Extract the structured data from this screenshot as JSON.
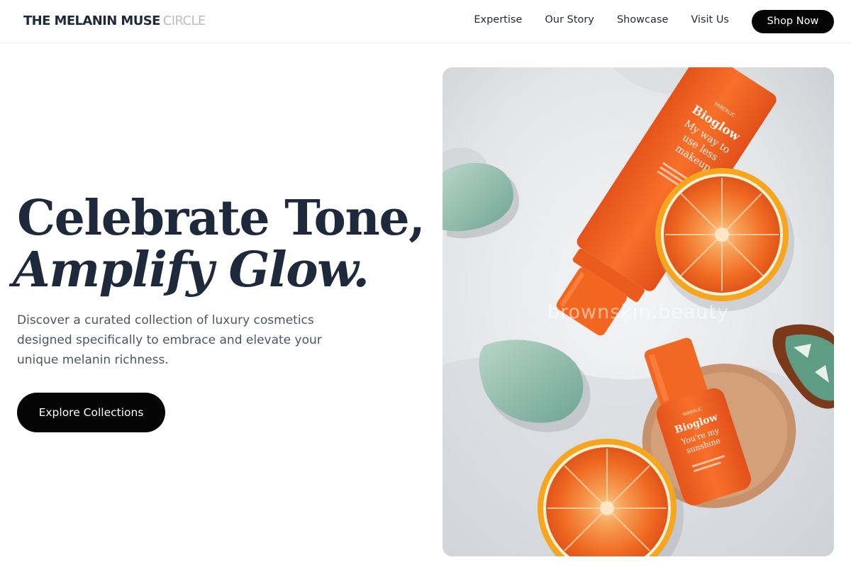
{
  "brand": {
    "name_bold": "THE MELANIN MUSE",
    "name_light": "CIRCLE"
  },
  "nav": {
    "links": [
      "Expertise",
      "Our Story",
      "Showcase",
      "Visit Us"
    ],
    "cta_label": "Shop Now"
  },
  "hero": {
    "headline_line1": "Celebrate Tone,",
    "headline_line2": "Amplify Glow.",
    "subtext": "Discover a curated collection of luxury cosmetics designed specifically to embrace and elevate your unique melanin richness.",
    "cta_label": "Explore Collections"
  },
  "image": {
    "watermark": "brownskin.beauty",
    "product_tube": {
      "brand": "FABERLIC",
      "name": "Bioglow",
      "tagline": "My way to use less makeup"
    },
    "product_bottle": {
      "brand": "FABERLIC",
      "name": "Bioglow",
      "tagline": "You're my sunshine"
    }
  },
  "colors": {
    "text_dark": "#1e2a3b",
    "text_muted": "#4c5563",
    "brand_light": "#b9bec6",
    "button_bg": "#050505",
    "product_orange": "#f2641c"
  }
}
